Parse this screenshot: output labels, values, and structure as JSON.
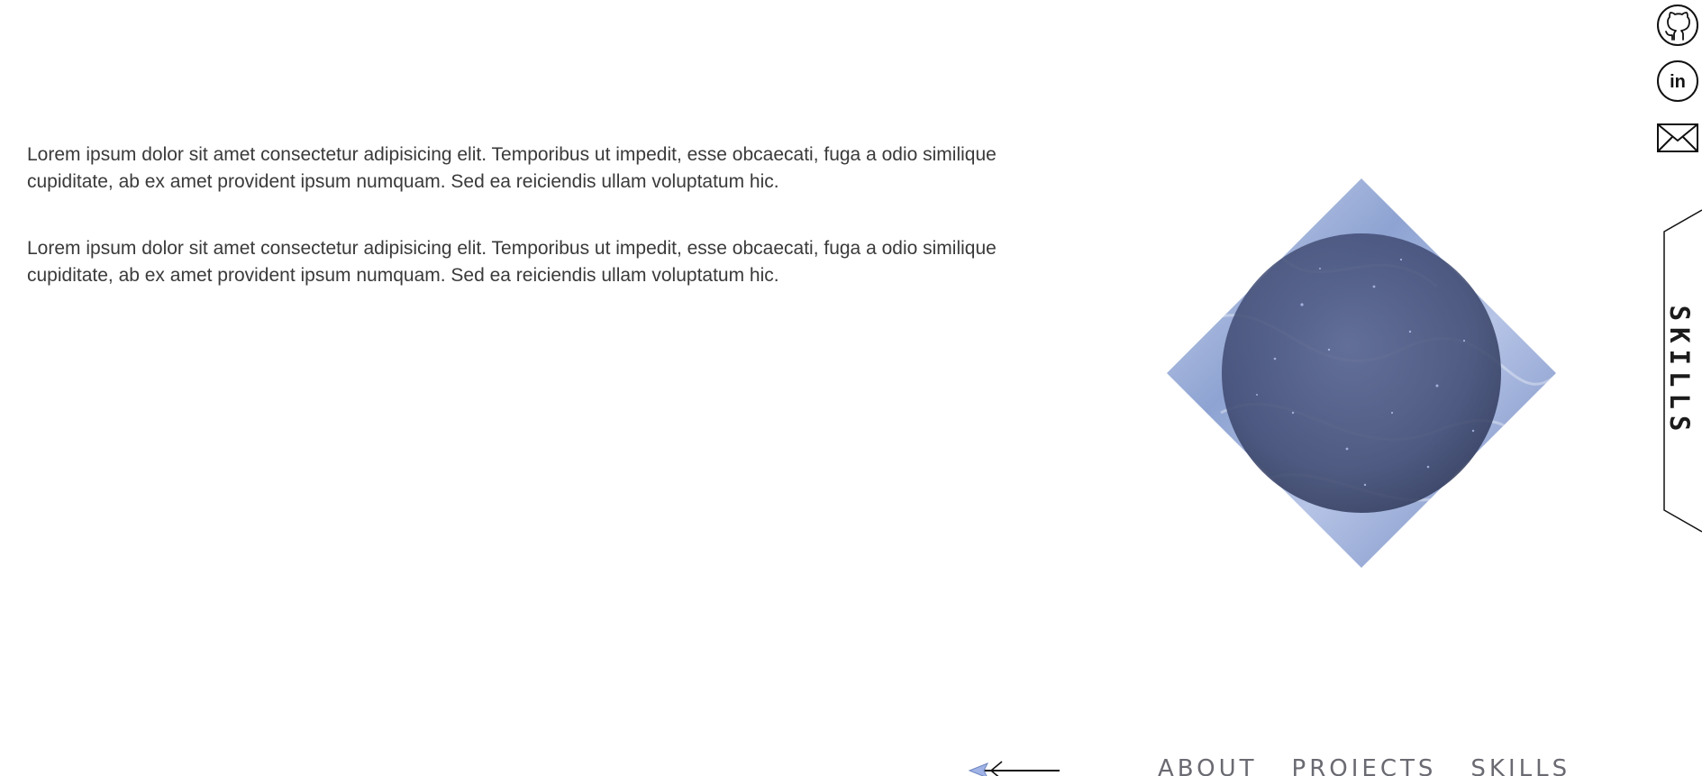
{
  "content": {
    "paragraphs": [
      "Lorem ipsum dolor sit amet consectetur adipisicing elit. Temporibus ut impedit, esse obcaecati, fuga a odio similique cupiditate, ab ex amet provident ipsum numquam. Sed ea reiciendis ullam voluptatum hic.",
      "Lorem ipsum dolor sit amet consectetur adipisicing elit. Temporibus ut impedit, esse obcaecati, fuga a odio similique cupiditate, ab ex amet provident ipsum numquam. Sed ea reiciendis ullam voluptatum hic."
    ]
  },
  "social": {
    "icons": [
      "github-icon",
      "linkedin-icon",
      "mail-icon"
    ]
  },
  "side_tab": {
    "label": "SKILLS"
  },
  "bottom_nav": {
    "back_icon": "arrow-left-icon",
    "links": [
      "ABOUT",
      "PROJECTS",
      "SKILLS"
    ]
  },
  "colors": {
    "text": "#3a3a3a",
    "nav": "#6a6a72",
    "accent": "#8fa6d6",
    "orb": "#4a5580"
  }
}
